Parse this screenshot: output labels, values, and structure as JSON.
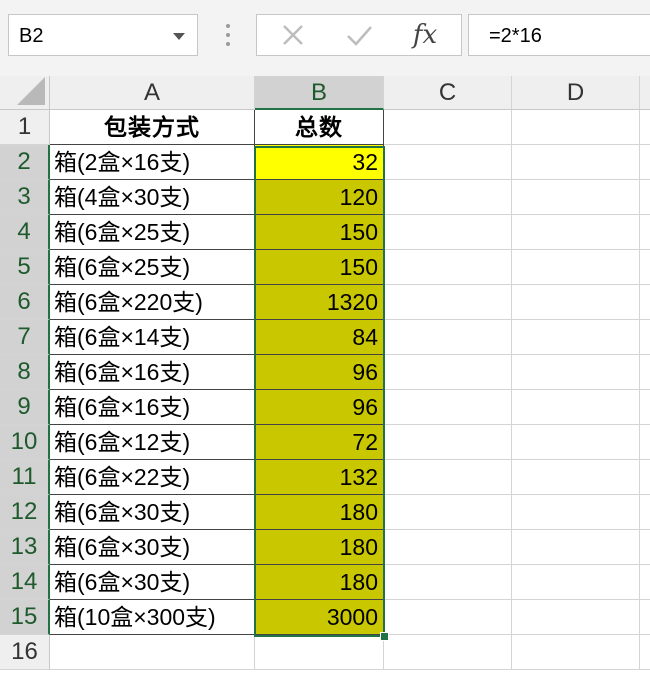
{
  "name_box": {
    "value": "B2"
  },
  "formula_bar": {
    "cancel_icon": "✕",
    "enter_icon": "✓",
    "fx_label": "fx",
    "formula": "=2*16"
  },
  "columns": [
    "A",
    "B",
    "C",
    "D"
  ],
  "header_row": {
    "row": "1",
    "a": "包装方式",
    "b": "总数"
  },
  "rows": [
    {
      "row": "2",
      "a": "箱(2盒×16支)",
      "b": "32"
    },
    {
      "row": "3",
      "a": "箱(4盒×30支)",
      "b": "120"
    },
    {
      "row": "4",
      "a": "箱(6盒×25支)",
      "b": "150"
    },
    {
      "row": "5",
      "a": "箱(6盒×25支)",
      "b": "150"
    },
    {
      "row": "6",
      "a": "箱(6盒×220支)",
      "b": "1320"
    },
    {
      "row": "7",
      "a": "箱(6盒×14支)",
      "b": "84"
    },
    {
      "row": "8",
      "a": "箱(6盒×16支)",
      "b": "96"
    },
    {
      "row": "9",
      "a": "箱(6盒×16支)",
      "b": "96"
    },
    {
      "row": "10",
      "a": "箱(6盒×12支)",
      "b": "72"
    },
    {
      "row": "11",
      "a": "箱(6盒×22支)",
      "b": "132"
    },
    {
      "row": "12",
      "a": "箱(6盒×30支)",
      "b": "180"
    },
    {
      "row": "13",
      "a": "箱(6盒×30支)",
      "b": "180"
    },
    {
      "row": "14",
      "a": "箱(6盒×30支)",
      "b": "180"
    },
    {
      "row": "15",
      "a": "箱(10盒×300支)",
      "b": "3000"
    }
  ],
  "empty_row": {
    "row": "16"
  },
  "colors": {
    "active_cell_fill": "#ffff00",
    "range_fill": "#c9c700",
    "selection_border": "#217346"
  }
}
